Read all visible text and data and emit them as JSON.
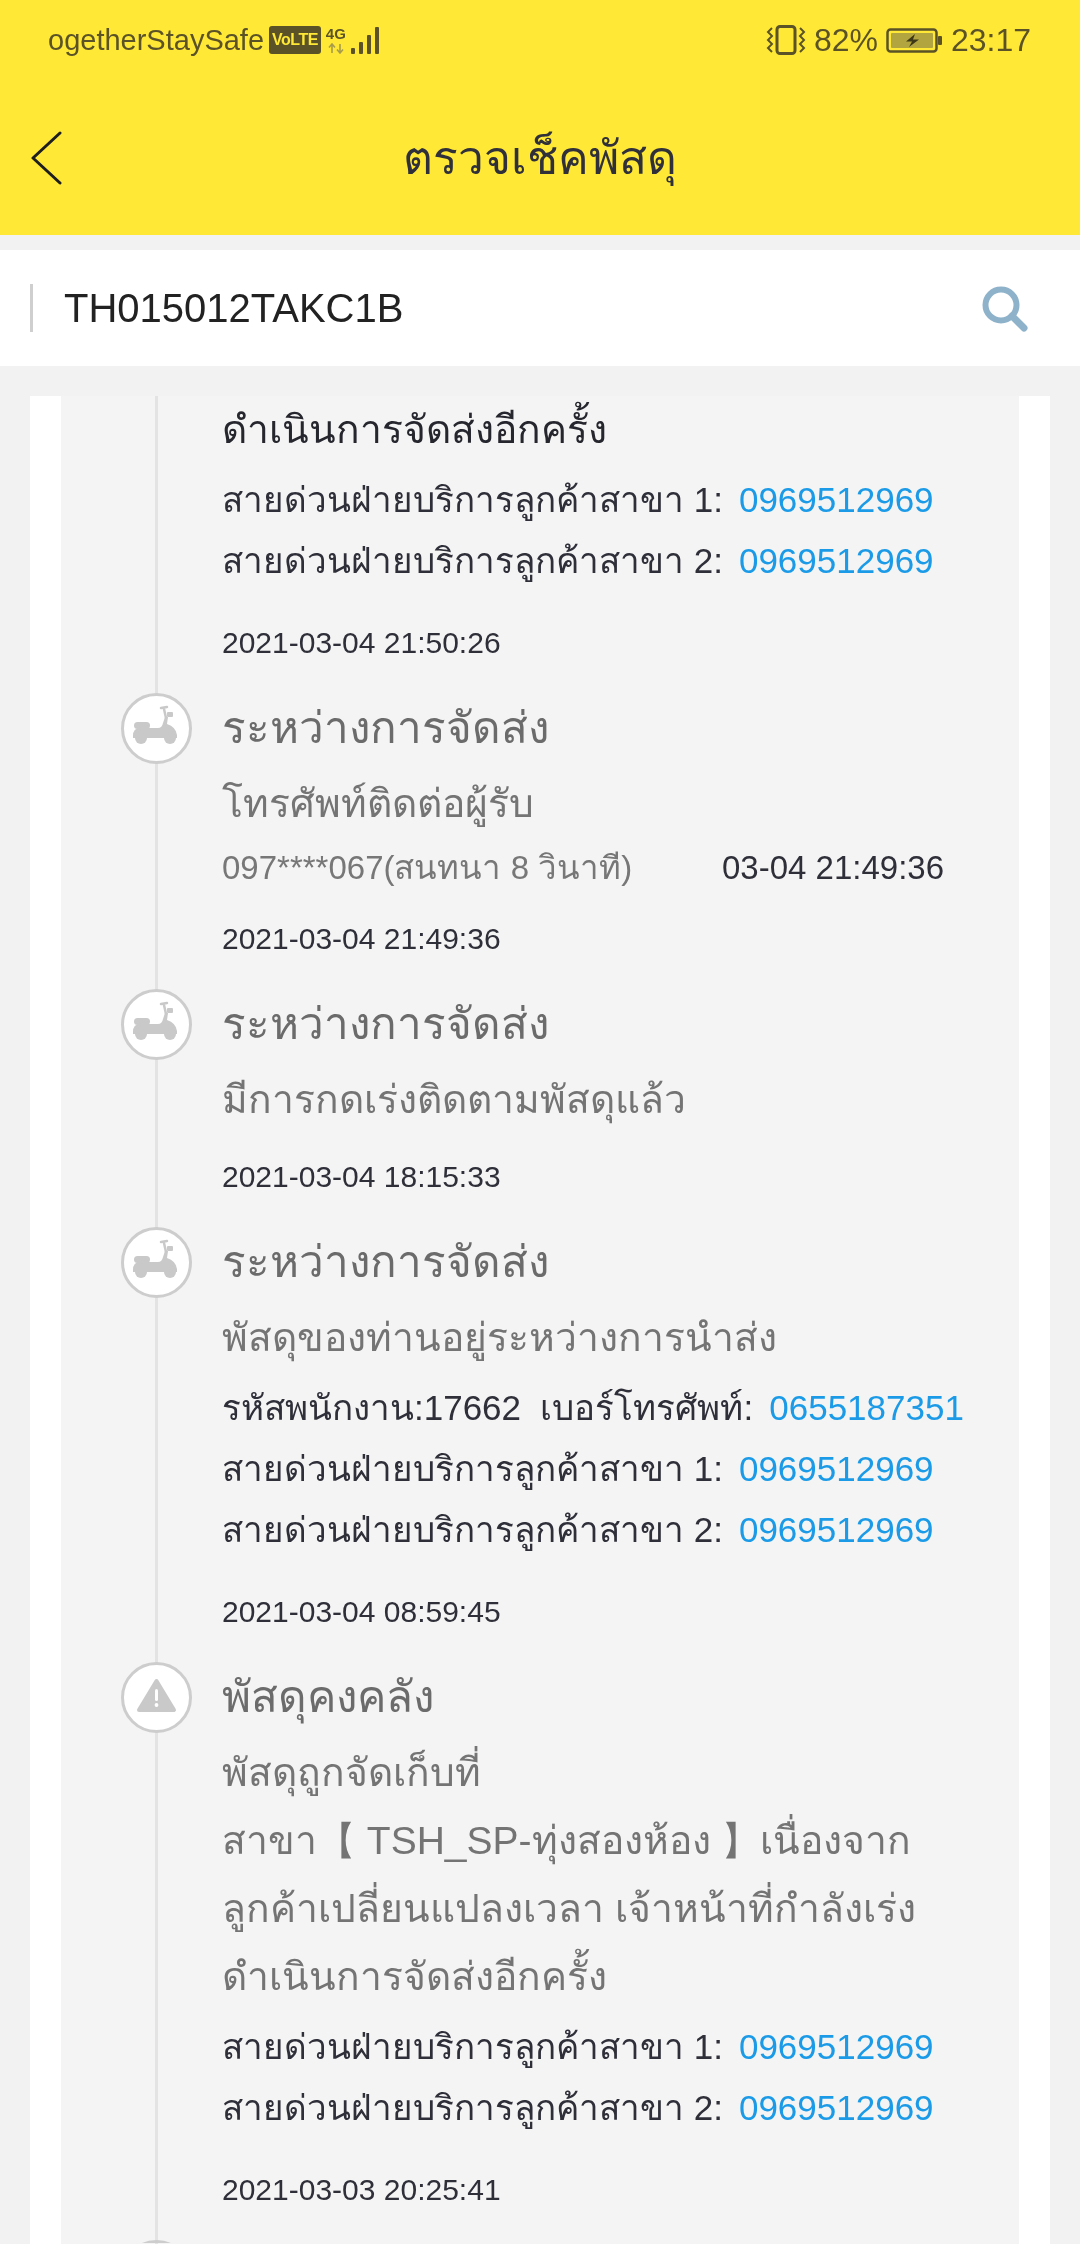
{
  "status_bar": {
    "carrier": "ogetherStaySafe",
    "volte": "VoLTE",
    "network": "4G",
    "battery": "82%",
    "time": "23:17"
  },
  "header": {
    "title": "ตรวจเช็คพัสดุ"
  },
  "search": {
    "value": "TH015012TAKC1B"
  },
  "timeline": {
    "more_below": true,
    "entries": [
      {
        "current": true,
        "description_lines": [
          "ดำเนินการจัดส่งอีกครั้ง"
        ],
        "details": [
          {
            "kind": "contact",
            "label": "สายด่วนฝ่ายบริการลูกค้าสาขา 1:",
            "phone": "0969512969"
          },
          {
            "kind": "contact",
            "label": "สายด่วนฝ่ายบริการลูกค้าสาขา 2:",
            "phone": "0969512969"
          }
        ],
        "time": "2021-03-04 21:50:26"
      },
      {
        "current": false,
        "kind": "delivery",
        "title": "ระหว่างการจัดส่ง",
        "description_lines": [
          "โทรศัพท์ติดต่อผู้รับ"
        ],
        "details": [
          {
            "kind": "call",
            "text": "097****067(สนทนา 8 วินาที)",
            "time": "03-04 21:49:36"
          }
        ],
        "time": "2021-03-04 21:49:36"
      },
      {
        "current": false,
        "kind": "delivery",
        "title": "ระหว่างการจัดส่ง",
        "description_lines": [
          "มีการกดเร่งติดตามพัสดุแล้ว"
        ],
        "time": "2021-03-04 18:15:33"
      },
      {
        "current": false,
        "kind": "delivery",
        "title": "ระหว่างการจัดส่ง",
        "description_lines": [
          "พัสดุของท่านอยู่ระหว่างการนำส่ง"
        ],
        "details": [
          {
            "kind": "contact",
            "label": "รหัสพนักงาน:17662  เบอร์โทรศัพท์:",
            "phone": "0655187351"
          },
          {
            "kind": "contact",
            "label": "สายด่วนฝ่ายบริการลูกค้าสาขา 1:",
            "phone": "0969512969"
          },
          {
            "kind": "contact",
            "label": "สายด่วนฝ่ายบริการลูกค้าสาขา 2:",
            "phone": "0969512969"
          }
        ],
        "time": "2021-03-04 08:59:45"
      },
      {
        "current": false,
        "kind": "alert",
        "title": "พัสดุคงคลัง",
        "description_lines": [
          "พัสดุถูกจัดเก็บที่",
          "สาขา【 TSH_SP-ทุ่งสองห้อง 】เนื่องจาก",
          "ลูกค้าเปลี่ยนแปลงเวลา เจ้าหน้าที่กำลังเร่ง",
          "ดำเนินการจัดส่งอีกครั้ง"
        ],
        "details": [
          {
            "kind": "contact",
            "label": "สายด่วนฝ่ายบริการลูกค้าสาขา 1:",
            "phone": "0969512969"
          },
          {
            "kind": "contact",
            "label": "สายด่วนฝ่ายบริการลูกค้าสาขา 2:",
            "phone": "0969512969"
          }
        ],
        "time": "2021-03-03 20:25:41"
      }
    ]
  }
}
